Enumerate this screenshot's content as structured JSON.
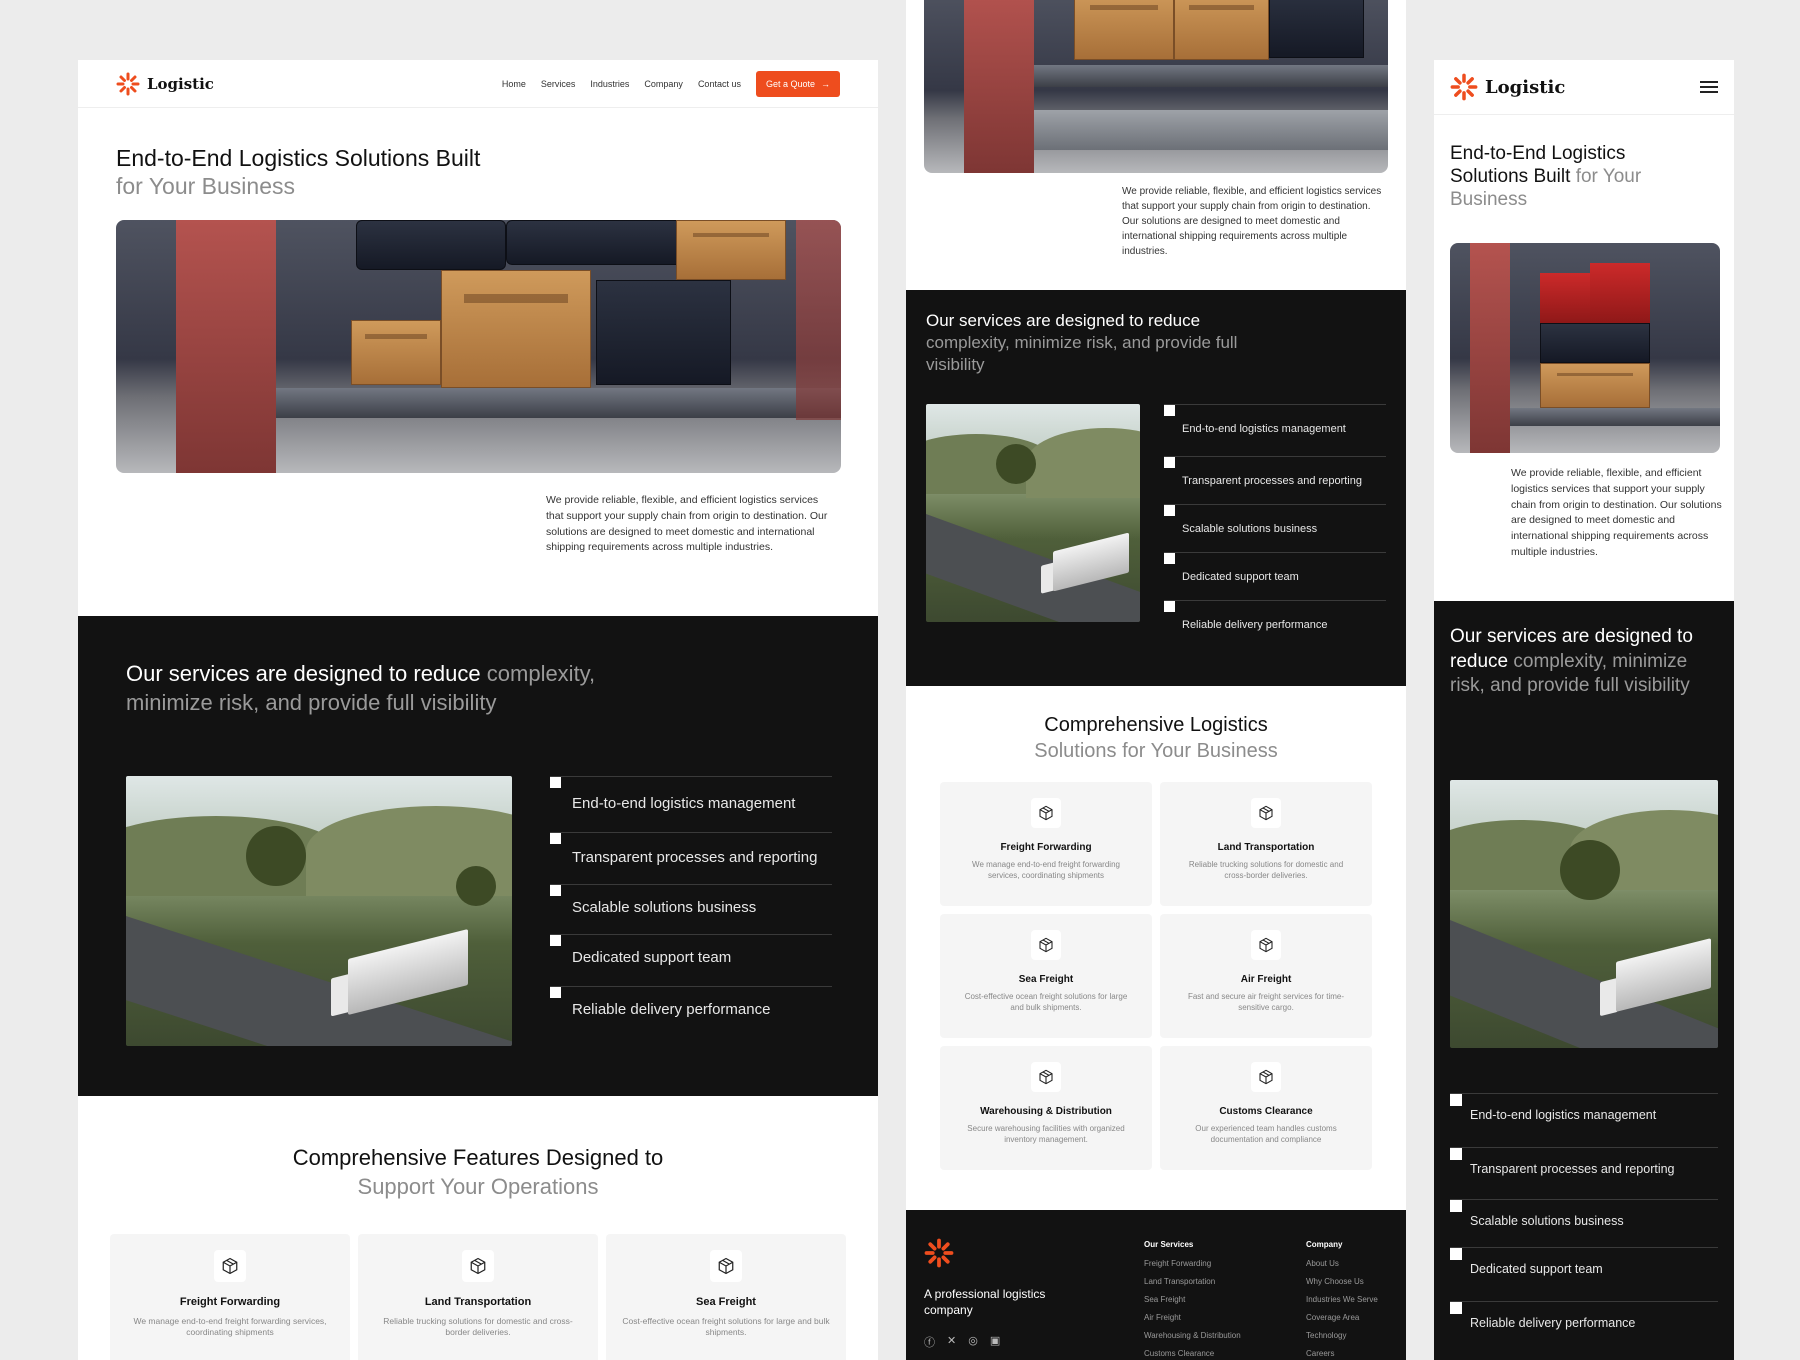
{
  "brand": {
    "name": "Logistic",
    "accent": "#ee4d1e",
    "dark_bg": "#121212"
  },
  "nav": {
    "items": [
      "Home",
      "Services",
      "Industries",
      "Company",
      "Contact us"
    ],
    "cta": "Get a Quote"
  },
  "hero": {
    "title_main": "End-to-End Logistics Solutions Built",
    "title_soft": "for Your Business",
    "mobile_title_main": "End-to-End Logistics Solutions Built",
    "mobile_title_soft": "for Your Business",
    "description": "We provide reliable, flexible, and efficient logistics services that support your supply chain from origin to destination. Our solutions are designed to meet domestic and international shipping requirements across multiple industries."
  },
  "services_intro": {
    "title_main": "Our services are designed to reduce",
    "title_soft": "complexity, minimize risk, and provide full visibility",
    "checklist": [
      "End-to-end logistics management",
      "Transparent processes and reporting",
      "Scalable solutions business",
      "Dedicated support team",
      "Reliable delivery performance"
    ]
  },
  "features_desktop": {
    "title_main": "Comprehensive Features Designed to",
    "title_soft": "Support Your Operations"
  },
  "features_tablet": {
    "title_main": "Comprehensive Logistics",
    "title_soft": "Solutions for Your Business"
  },
  "cards": [
    {
      "title": "Freight Forwarding",
      "desc": "We manage end-to-end freight forwarding services, coordinating shipments",
      "icon": "box-icon"
    },
    {
      "title": "Land Transportation",
      "desc": "Reliable trucking solutions for domestic and cross-border deliveries.",
      "icon": "box-icon"
    },
    {
      "title": "Sea Freight",
      "desc": "Cost-effective ocean freight solutions for large and bulk shipments.",
      "icon": "box-icon"
    },
    {
      "title": "Air Freight",
      "desc": "Fast and secure air freight services for time-sensitive cargo.",
      "icon": "box-icon"
    },
    {
      "title": "Warehousing & Distribution",
      "desc": "Secure warehousing facilities with organized inventory management.",
      "icon": "box-icon"
    },
    {
      "title": "Customs Clearance",
      "desc": "Our experienced team handles customs documentation and compliance",
      "icon": "box-icon"
    }
  ],
  "footer": {
    "tagline": "A professional logistics company",
    "services_heading": "Our Services",
    "services": [
      "Freight Forwarding",
      "Land Transportation",
      "Sea Freight",
      "Air Freight",
      "Warehousing & Distribution",
      "Customs Clearance"
    ],
    "company_heading": "Company",
    "company": [
      "About Us",
      "Why Choose Us",
      "Industries We Serve",
      "Coverage Area",
      "Technology",
      "Careers"
    ],
    "social": [
      "facebook-icon",
      "x-icon",
      "instagram-icon",
      "linkedin-icon"
    ]
  }
}
